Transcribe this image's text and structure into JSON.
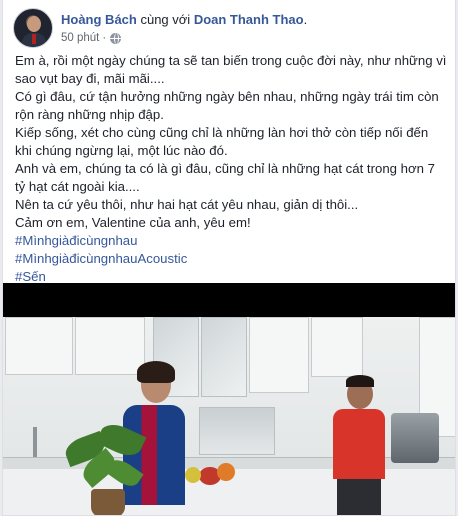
{
  "post": {
    "author": "Hoàng Bách",
    "with_text": "cùng với",
    "tagged": "Doan Thanh Thao",
    "period": ".",
    "time": "50 phút",
    "separator": "·",
    "privacy_icon": "globe-icon",
    "menu_icon": "more-options-icon",
    "menu_glyph": "···",
    "lines": [
      "Em à, rồi một ngày chúng ta sẽ tan biến trong cuộc đời này, như những vì sao vụt bay đi, mãi mãi....",
      "Có gì đâu, cứ tận hưởng những ngày bên nhau, những ngày trái tim còn rộn ràng những nhịp đập.",
      "Kiếp sống, xét cho cùng cũng chỉ là những làn hơi thở còn tiếp nối đến khi chúng ngừng lại, một lúc nào đó.",
      "Anh và em, chúng ta có là gì đâu, cũng chỉ là những hạt cát trong hơn 7 tỷ hạt cát ngoài kia....",
      "Nên ta cứ yêu thôi, như hai hạt cát yêu nhau, giản dị thôi...",
      "Cảm ơn em, Valentine của anh, yêu em!"
    ],
    "hashtags": [
      "#Mìnhgiàđicùngnhau",
      "#MìnhgiàđicùngnhauAcoustic",
      "#Sến"
    ]
  },
  "colors": {
    "link": "#365899",
    "text": "#1d2129",
    "meta": "#616770"
  }
}
